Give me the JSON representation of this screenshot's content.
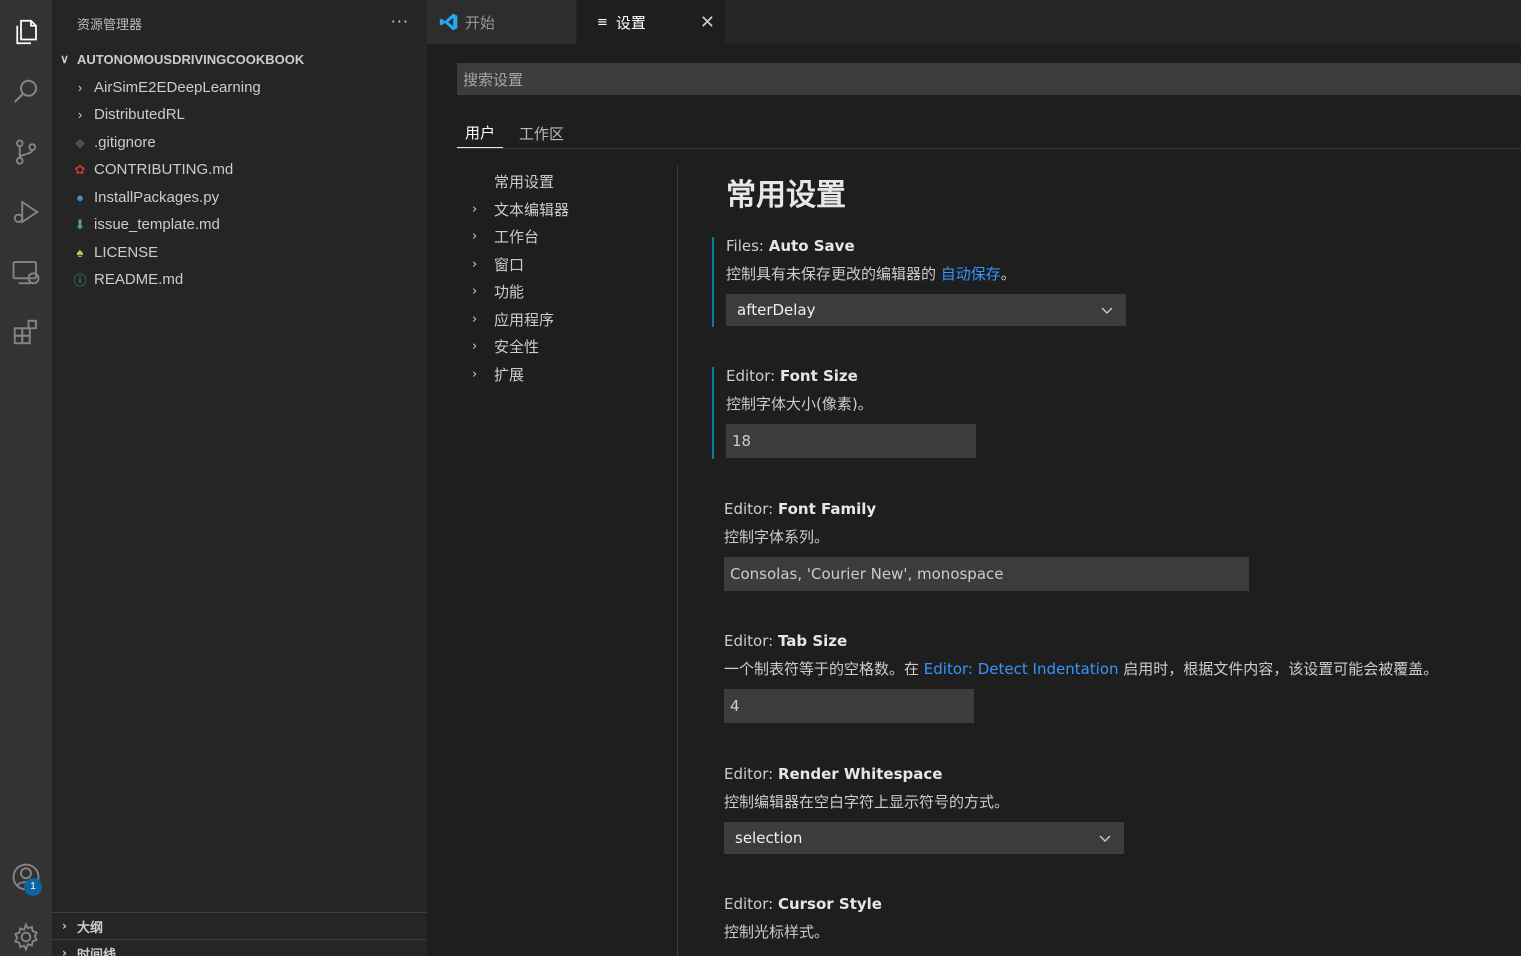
{
  "activity_bar": {
    "icons": [
      "files-icon",
      "search-icon",
      "source-control-icon",
      "run-debug-icon",
      "remote-explorer-icon",
      "extensions-icon",
      "account-icon",
      "settings-gear-icon"
    ],
    "account_badge": "1"
  },
  "sidebar": {
    "title": "资源管理器",
    "more": "···",
    "root_folder": "AUTONOMOUSDRIVINGCOOKBOOK",
    "items": [
      {
        "label": "AirSimE2EDeepLearning",
        "type": "folder"
      },
      {
        "label": "DistributedRL",
        "type": "folder"
      },
      {
        "label": ".gitignore",
        "type": "file",
        "icon": "git-icon",
        "color": "#41535b"
      },
      {
        "label": "CONTRIBUTING.md",
        "type": "file",
        "icon": "ribbon-icon",
        "color": "#c0392b"
      },
      {
        "label": "InstallPackages.py",
        "type": "file",
        "icon": "python-icon",
        "color": "#4b8bbe"
      },
      {
        "label": "issue_template.md",
        "type": "file",
        "icon": "arrow-down-icon",
        "color": "#519aba"
      },
      {
        "label": "LICENSE",
        "type": "file",
        "icon": "license-icon",
        "color": "#cbcb41"
      },
      {
        "label": "README.md",
        "type": "file",
        "icon": "info-icon",
        "color": "#519aba"
      }
    ],
    "outline": "大纲",
    "timeline": "时间线"
  },
  "tabs": {
    "start": "开始",
    "settings": "设置",
    "close": "✕"
  },
  "settings": {
    "search_placeholder": "搜索设置",
    "scope_user": "用户",
    "scope_workspace": "工作区",
    "toc": [
      {
        "label": "常用设置",
        "expandable": false
      },
      {
        "label": "文本编辑器",
        "expandable": true
      },
      {
        "label": "工作台",
        "expandable": true
      },
      {
        "label": "窗口",
        "expandable": true
      },
      {
        "label": "功能",
        "expandable": true
      },
      {
        "label": "应用程序",
        "expandable": true
      },
      {
        "label": "安全性",
        "expandable": true
      },
      {
        "label": "扩展",
        "expandable": true
      }
    ],
    "section_title": "常用设置",
    "auto_save": {
      "category": "Files: ",
      "name": "Auto Save",
      "desc_before": "控制具有未保存更改的编辑器的 ",
      "desc_link": "自动保存",
      "desc_after": "。",
      "value": "afterDelay"
    },
    "font_size": {
      "category": "Editor: ",
      "name": "Font Size",
      "desc": "控制字体大小(像素)。",
      "value": "18"
    },
    "font_family": {
      "category": "Editor: ",
      "name": "Font Family",
      "desc": "控制字体系列。",
      "value": "Consolas, 'Courier New', monospace"
    },
    "tab_size": {
      "category": "Editor: ",
      "name": "Tab Size",
      "desc_before": "一个制表符等于的空格数。在 ",
      "desc_link": "Editor: Detect Indentation",
      "desc_after": " 启用时，根据文件内容，该设置可能会被覆盖。",
      "value": "4"
    },
    "render_whitespace": {
      "category": "Editor: ",
      "name": "Render Whitespace",
      "desc": "控制编辑器在空白字符上显示符号的方式。",
      "value": "selection"
    },
    "cursor_style": {
      "category": "Editor: ",
      "name": "Cursor Style",
      "desc": "控制光标样式。"
    }
  }
}
